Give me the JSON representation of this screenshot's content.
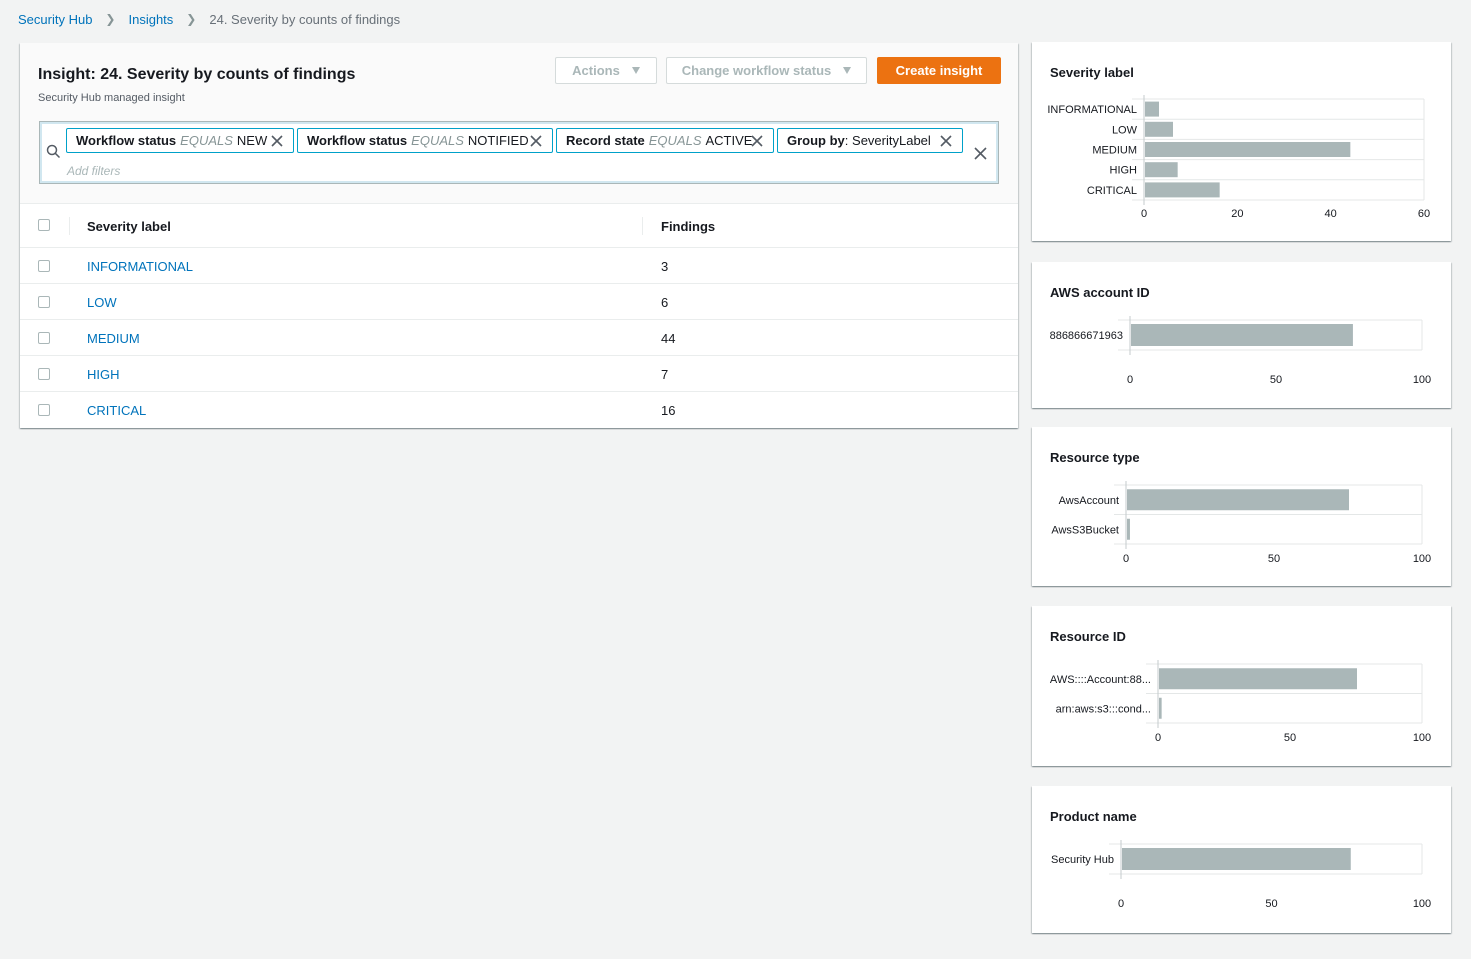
{
  "breadcrumb": {
    "root": "Security Hub",
    "parent": "Insights",
    "current": "24. Severity by counts of findings"
  },
  "insight": {
    "title": "Insight: 24. Severity by counts of findings",
    "subtitle": "Security Hub managed insight"
  },
  "toolbar": {
    "actions_label": "Actions",
    "workflow_label": "Change workflow status",
    "create_label": "Create insight",
    "primary_color": "#ec7211"
  },
  "filters": {
    "chips": [
      {
        "key": "Workflow status",
        "op": "EQUALS",
        "value": "NEW"
      },
      {
        "key": "Workflow status",
        "op": "EQUALS",
        "value": "NOTIFIED"
      },
      {
        "key": "Record state",
        "op": "EQUALS",
        "value": "ACTIVE"
      },
      {
        "key": "Group by",
        "sep": ":",
        "value": "SeverityLabel"
      }
    ],
    "placeholder": "Add filters"
  },
  "table": {
    "headers": {
      "label": "Severity label",
      "count": "Findings"
    },
    "rows": [
      {
        "label": "INFORMATIONAL",
        "count": "3"
      },
      {
        "label": "LOW",
        "count": "6"
      },
      {
        "label": "MEDIUM",
        "count": "44"
      },
      {
        "label": "HIGH",
        "count": "7"
      },
      {
        "label": "CRITICAL",
        "count": "16"
      }
    ]
  },
  "cards": [
    {
      "title": "Severity label"
    },
    {
      "title": "AWS account ID"
    },
    {
      "title": "Resource type"
    },
    {
      "title": "Resource ID"
    },
    {
      "title": "Product name"
    }
  ],
  "chart_data": [
    {
      "type": "bar",
      "orientation": "horizontal",
      "title": "Severity label",
      "categories": [
        "INFORMATIONAL",
        "LOW",
        "MEDIUM",
        "HIGH",
        "CRITICAL"
      ],
      "values": [
        3,
        6,
        44,
        7,
        16
      ],
      "xlim": [
        0,
        60
      ],
      "ticks": [
        0,
        20,
        40,
        60
      ],
      "grid": true,
      "bar_color": "#aab7b8"
    },
    {
      "type": "bar",
      "orientation": "horizontal",
      "title": "AWS account ID",
      "categories": [
        "886866671963"
      ],
      "values": [
        76
      ],
      "xlim": [
        0,
        100
      ],
      "ticks": [
        0,
        50,
        100
      ],
      "grid": true,
      "bar_color": "#aab7b8"
    },
    {
      "type": "bar",
      "orientation": "horizontal",
      "title": "Resource type",
      "categories": [
        "AwsAccount",
        "AwsS3Bucket"
      ],
      "values": [
        75,
        1
      ],
      "xlim": [
        0,
        100
      ],
      "ticks": [
        0,
        50,
        100
      ],
      "grid": true,
      "bar_color": "#aab7b8"
    },
    {
      "type": "bar",
      "orientation": "horizontal",
      "title": "Resource ID",
      "categories": [
        "AWS::::Account:88...",
        "arn:aws:s3:::cond..."
      ],
      "values": [
        75,
        1
      ],
      "xlim": [
        0,
        100
      ],
      "ticks": [
        0,
        50,
        100
      ],
      "grid": true,
      "bar_color": "#aab7b8"
    },
    {
      "type": "bar",
      "orientation": "horizontal",
      "title": "Product name",
      "categories": [
        "Security Hub"
      ],
      "values": [
        76
      ],
      "xlim": [
        0,
        100
      ],
      "ticks": [
        0,
        50,
        100
      ],
      "grid": true,
      "bar_color": "#aab7b8"
    }
  ]
}
